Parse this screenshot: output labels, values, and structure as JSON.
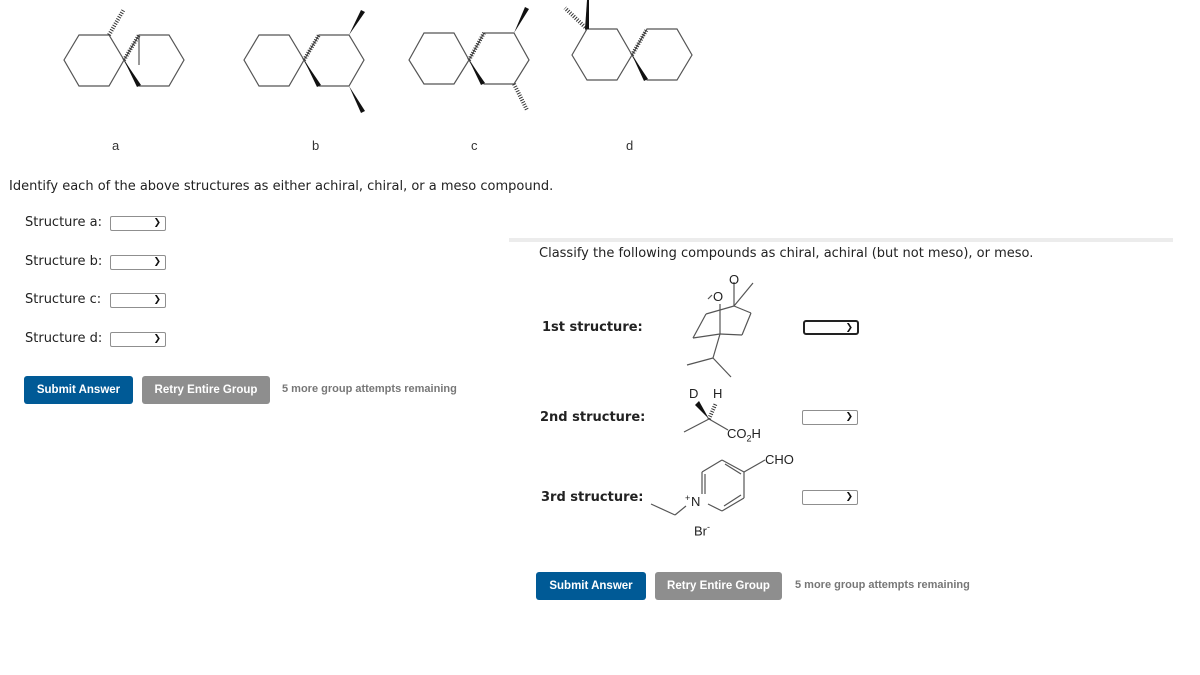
{
  "question1": {
    "structure_labels": [
      "a",
      "b",
      "c",
      "d"
    ],
    "prompt": "Identify each of the above structures as either achiral, chiral, or a meso compound.",
    "fields": [
      {
        "label": "Structure a:",
        "value": ""
      },
      {
        "label": "Structure b:",
        "value": ""
      },
      {
        "label": "Structure c:",
        "value": ""
      },
      {
        "label": "Structure d:",
        "value": ""
      }
    ],
    "submit_label": "Submit Answer",
    "retry_label": "Retry Entire Group",
    "attempts_text": "5 more group attempts remaining"
  },
  "question2": {
    "prompt": "Classify the following compounds as chiral, achiral (but not meso), or meso.",
    "rows": [
      {
        "label": "1st structure:",
        "value": "",
        "atoms": [
          "O",
          "O"
        ]
      },
      {
        "label": "2nd structure:",
        "value": "",
        "atoms": [
          "D",
          "H",
          "CO",
          "2",
          "H"
        ]
      },
      {
        "label": "3rd structure:",
        "value": "",
        "atoms": [
          "+",
          "N",
          "CHO",
          "Br",
          "-"
        ]
      }
    ],
    "submit_label": "Submit Answer",
    "retry_label": "Retry Entire Group",
    "attempts_text": "5 more group attempts remaining"
  },
  "colors": {
    "primary_button": "#005a96",
    "secondary_button": "#8e8e8e",
    "attempts_text": "#777777"
  }
}
